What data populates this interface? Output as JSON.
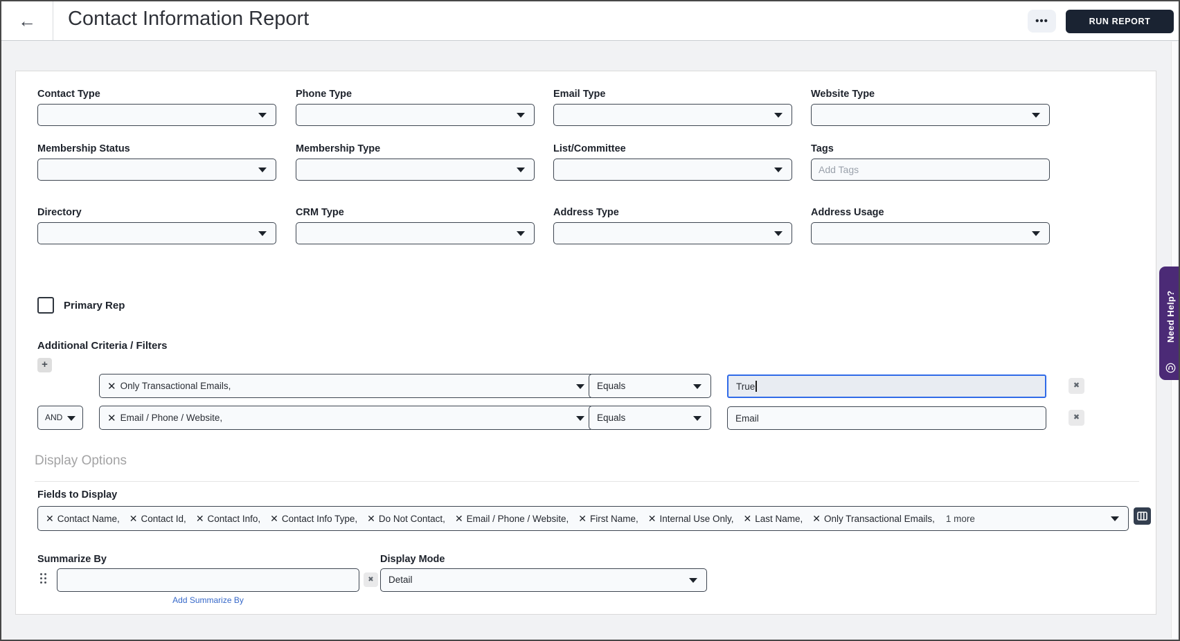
{
  "header": {
    "back_icon": "←",
    "title": "Contact Information Report",
    "more_button": "•••",
    "run_report": "RUN REPORT"
  },
  "icons": {
    "clear_x": "✕",
    "remove_x": "✖",
    "plus": "+"
  },
  "fields": [
    {
      "label": "Contact Type"
    },
    {
      "label": "Phone Type"
    },
    {
      "label": "Email Type"
    },
    {
      "label": "Website Type"
    },
    {
      "label": "Membership Status"
    },
    {
      "label": "Membership Type"
    },
    {
      "label": "List/Committee"
    },
    {
      "label": "Tags",
      "placeholder": "Add Tags"
    },
    {
      "label": "Directory"
    },
    {
      "label": "CRM Type"
    },
    {
      "label": "Address Type"
    },
    {
      "label": "Address Usage"
    }
  ],
  "primary_rep": {
    "label": "Primary Rep",
    "checked": false
  },
  "criteria": {
    "title": "Additional Criteria / Filters",
    "rows": [
      {
        "conjunction": "",
        "field": "Only Transactional Emails,",
        "operator": "Equals",
        "value": "True",
        "focused": true
      },
      {
        "conjunction": "AND",
        "field": "Email / Phone / Website,",
        "operator": "Equals",
        "value": "Email",
        "focused": false
      }
    ]
  },
  "display_options": {
    "title": "Display Options",
    "fields_to_display": {
      "label": "Fields to Display",
      "chips": [
        "Contact Name,",
        "Contact Id,",
        "Contact Info,",
        "Contact Info Type,",
        "Do Not Contact,",
        "Email / Phone / Website,",
        "First Name,",
        "Internal Use Only,",
        "Last Name,",
        "Only Transactional Emails,"
      ],
      "overflow": "1 more"
    },
    "summarize_by": {
      "label": "Summarize By",
      "value": "",
      "add_link": "Add Summarize By"
    },
    "display_mode": {
      "label": "Display Mode",
      "value": "Detail"
    }
  },
  "help_tab": {
    "label": "Need Help?"
  },
  "colors": {
    "focus_border": "#2f6ae8",
    "run_button_bg": "#1a2332",
    "help_tab_bg": "#4b2a76",
    "link": "#3668c9"
  }
}
